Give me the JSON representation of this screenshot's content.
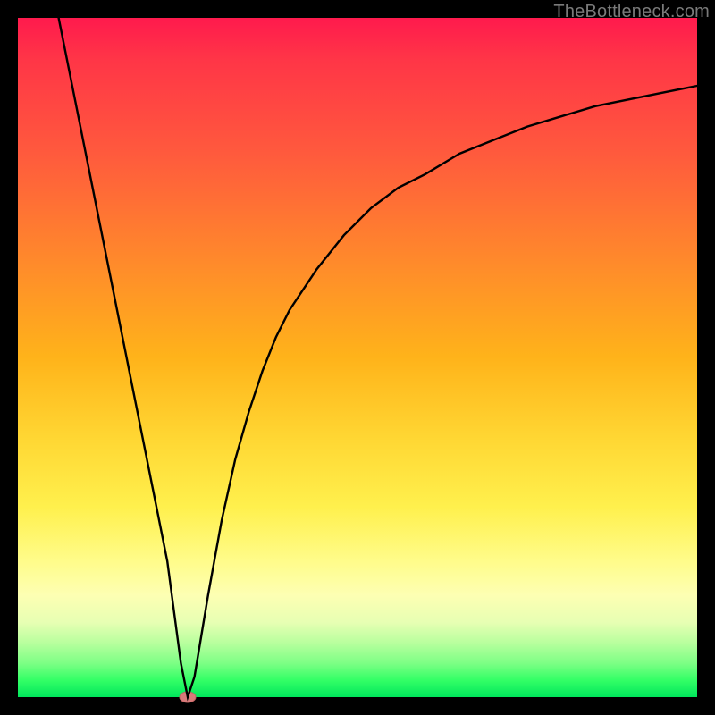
{
  "watermark": {
    "text": "TheBottleneck.com"
  },
  "chart_data": {
    "type": "line",
    "title": "",
    "xlabel": "",
    "ylabel": "",
    "xlim": [
      0,
      100
    ],
    "ylim": [
      0,
      100
    ],
    "grid": false,
    "legend": false,
    "background_gradient": {
      "direction": "top-to-bottom",
      "stops": [
        {
          "pos": 0.0,
          "color": "#ff1a4d"
        },
        {
          "pos": 0.2,
          "color": "#ff5a3d"
        },
        {
          "pos": 0.5,
          "color": "#ffb31a"
        },
        {
          "pos": 0.72,
          "color": "#fff04d"
        },
        {
          "pos": 0.85,
          "color": "#fdffb3"
        },
        {
          "pos": 0.95,
          "color": "#7dff85"
        },
        {
          "pos": 1.0,
          "color": "#00e65c"
        }
      ]
    },
    "series": [
      {
        "name": "bottleneck-curve",
        "color": "#000000",
        "x": [
          6,
          8,
          10,
          12,
          14,
          16,
          18,
          20,
          22,
          24,
          25,
          26,
          28,
          30,
          32,
          34,
          36,
          38,
          40,
          44,
          48,
          52,
          56,
          60,
          65,
          70,
          75,
          80,
          85,
          90,
          95,
          100
        ],
        "y": [
          100,
          90,
          80,
          70,
          60,
          50,
          40,
          30,
          20,
          5,
          0,
          3,
          15,
          26,
          35,
          42,
          48,
          53,
          57,
          63,
          68,
          72,
          75,
          77,
          80,
          82,
          84,
          85.5,
          87,
          88,
          89,
          90
        ]
      }
    ],
    "marker": {
      "name": "minimum-point",
      "x": 25,
      "y": 0,
      "color": "#d87a7a",
      "shape": "ellipse"
    }
  }
}
